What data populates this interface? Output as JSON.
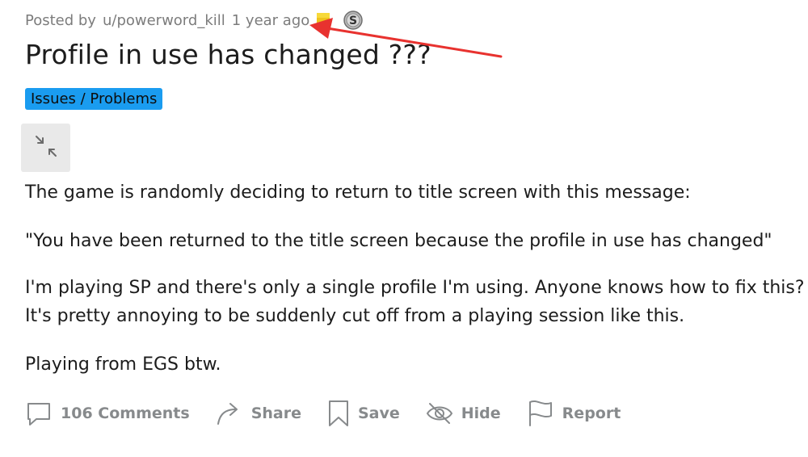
{
  "post": {
    "posted_by_prefix": "Posted by",
    "author": "u/powerword_kill",
    "age": "1 year ago",
    "title": "Profile in use has changed ???",
    "flair": "Issues / Problems",
    "body": {
      "p1": "The game is randomly deciding to return to title screen with this message:",
      "p2": "\"You have been returned to the title screen because the profile in use has changed\"",
      "p3a": "I'm playing SP and there's only a single profile I'm using. Anyone knows how to fix this?",
      "p3b": "It's pretty annoying to be suddenly cut off from a playing session like this.",
      "p4": "Playing from EGS btw."
    }
  },
  "awards": {
    "gold_icon": "gold-award-icon",
    "silver_icon": "silver-award-icon"
  },
  "actions": {
    "comments": "106 Comments",
    "share": "Share",
    "save": "Save",
    "hide": "Hide",
    "report": "Report"
  },
  "annotation": {
    "arrow_color": "#e8322f"
  },
  "colors": {
    "flair_bg": "#1a9cf0",
    "muted_text": "#7c7c7c",
    "action_text": "#878a8c"
  }
}
